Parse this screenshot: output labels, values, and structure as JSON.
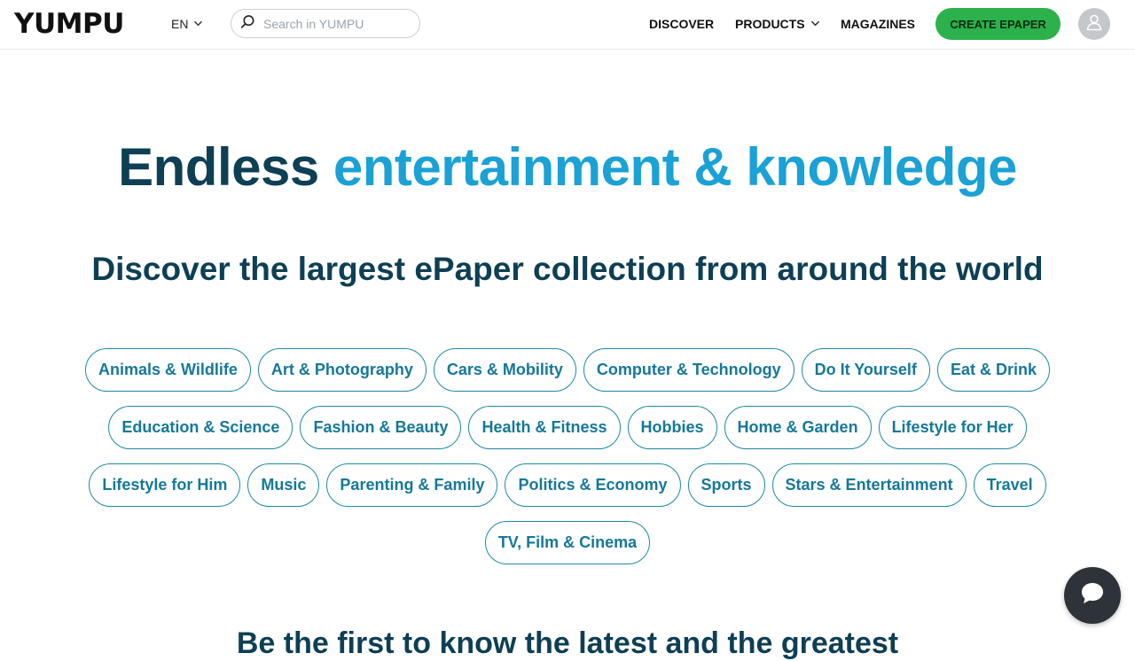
{
  "header": {
    "logo": "YUMPU",
    "language": "EN",
    "search": {
      "placeholder": "Search in YUMPU",
      "value": ""
    },
    "nav": {
      "discover": "DISCOVER",
      "products": "PRODUCTS",
      "magazines": "MAGAZINES"
    },
    "cta": "CREATE EPAPER"
  },
  "hero": {
    "title_dark": "Endless",
    "title_light": "entertainment & knowledge",
    "subtitle": "Discover the largest ePaper collection from around the world"
  },
  "categories": [
    "Animals & Wildlife",
    "Art & Photography",
    "Cars & Mobility",
    "Computer & Technology",
    "Do It Yourself",
    "Eat & Drink",
    "Education & Science",
    "Fashion & Beauty",
    "Health & Fitness",
    "Hobbies",
    "Home & Garden",
    "Lifestyle for Her",
    "Lifestyle for Him",
    "Music",
    "Parenting & Family",
    "Politics & Economy",
    "Sports",
    "Stars & Entertainment",
    "Travel",
    "TV, Film & Cinema"
  ],
  "teaser": "Be the first to know the latest and the greatest",
  "colors": {
    "brand_dark": "#0d3f55",
    "brand_light": "#1aa1d6",
    "cta_green": "#2bb24c",
    "chip_border": "#1b8aa6"
  },
  "icons": {
    "search": "search-icon",
    "language_chevron": "chevron-down-icon",
    "products_chevron": "chevron-down-icon",
    "avatar": "user-icon",
    "chat": "chat-bubble-icon"
  }
}
